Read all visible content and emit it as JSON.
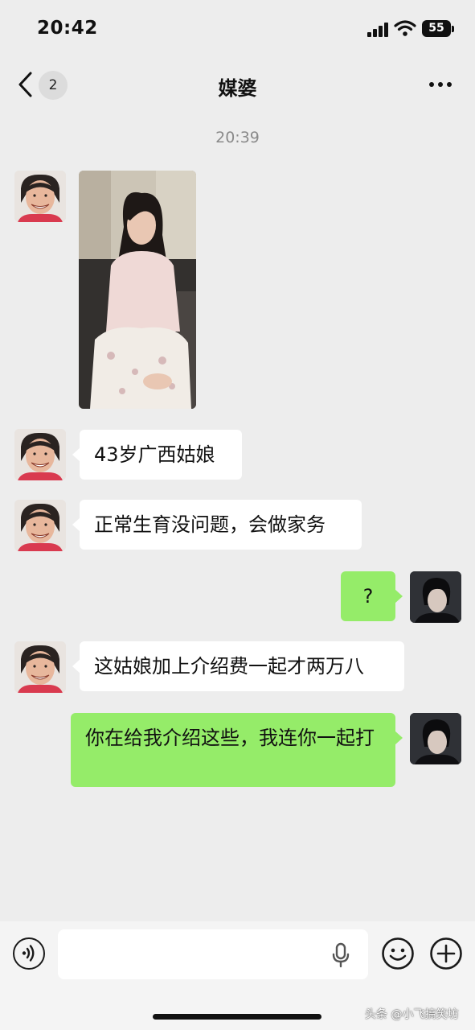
{
  "status_bar": {
    "time": "20:42",
    "battery": "55"
  },
  "nav": {
    "unread_count": "2",
    "title": "媒婆"
  },
  "chat": {
    "timestamp": "20:39",
    "messages": [
      {
        "text": "43岁广西姑娘"
      },
      {
        "text": "正常生育没问题，会做家务"
      },
      {
        "text": "?"
      },
      {
        "text": "这姑娘加上介绍费一起才两万八"
      },
      {
        "text": "你在给我介绍这些，我连你一起打"
      }
    ]
  },
  "input_bar": {
    "value": "",
    "placeholder": ""
  },
  "watermark": "头条 @小飞搞笑坊",
  "icons": [
    "back-icon",
    "more-icon",
    "voice-icon",
    "mic-icon",
    "emoji-icon",
    "plus-icon"
  ],
  "colors": {
    "background": "#ededed",
    "outgoing_bubble": "#95ec69",
    "incoming_bubble": "#ffffff"
  }
}
